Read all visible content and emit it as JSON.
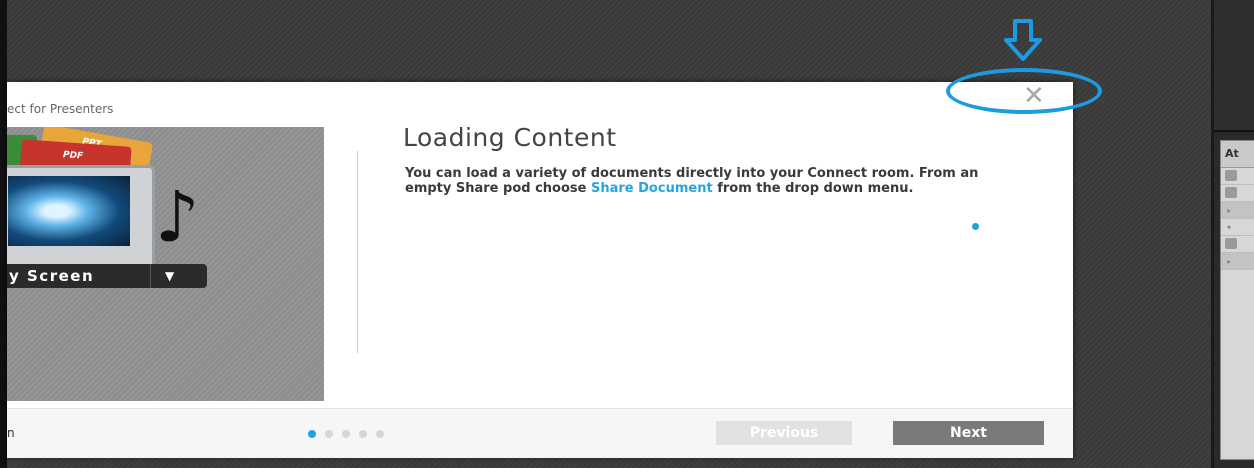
{
  "dialog": {
    "title": "ect for Presenters",
    "close_icon": "close-icon",
    "illustration": {
      "doc_labels": [
        "PPT",
        "PDF"
      ],
      "share_button_label": "y Screen",
      "note_glyph": "♪"
    },
    "content": {
      "heading": "Loading Content",
      "body_text": "You can load a variety of documents directly into your Connect room. From an empty Share pod choose ",
      "body_link": "Share Document",
      "body_tail": " from the drop down menu."
    },
    "footer": {
      "left_text": "n",
      "page_count": 5,
      "active_page": 1,
      "previous_label": "Previous",
      "next_label": "Next"
    }
  },
  "right_panel": {
    "pod_header": "At"
  },
  "colors": {
    "accent": "#1da1e0",
    "annotation": "#1c9be0",
    "next_button": "#7a7a7a",
    "previous_button_disabled": "#e2e2e2"
  }
}
